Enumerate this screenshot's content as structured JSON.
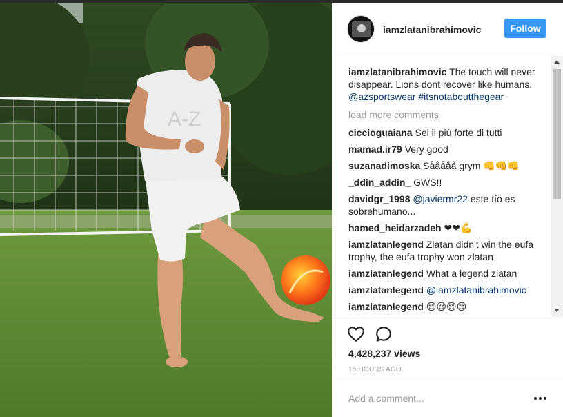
{
  "post": {
    "username": "iamzlatanibrahimovic",
    "follow_label": "Follow",
    "caption": {
      "username": "iamzlatanibrahimovic",
      "text": "The touch will never disappear. Lions dont recover like humans.",
      "mention": "@azsportswear",
      "hashtag": "#itsnotaboutthegear"
    },
    "shirt_text": "A-Z"
  },
  "comments": {
    "load_more_label": "load more comments",
    "items": [
      {
        "user": "ciccioguaiana",
        "text": "Sei il più forte di tutti"
      },
      {
        "user": "mamad.ir79",
        "text": "Very good"
      },
      {
        "user": "suzanadimoska",
        "text": "Sååååå grym 👊👊👊"
      },
      {
        "user": "_ddin_addin_",
        "text": "GWS!!"
      },
      {
        "user": "davidgr_1998",
        "mention": "@javiermr22",
        "text": "este tío es sobrehumano..."
      },
      {
        "user": "hamed_heidarzadeh",
        "text": "❤❤💪"
      },
      {
        "user": "iamzlatanlegend",
        "text": "Zlatan didn't win the eufa trophy, the eufa trophy won zlatan"
      },
      {
        "user": "iamzlatanlegend",
        "text": "What a legend zlatan"
      },
      {
        "user": "iamzlatanlegend",
        "mention": "@iamzlatanibrahimovic"
      },
      {
        "user": "iamzlatanlegend",
        "text": "😌😌😌😌"
      }
    ]
  },
  "actions": {
    "like_icon": "heart-icon",
    "comment_icon": "speech-bubble-icon",
    "views": "4,428,237 views",
    "time": "15 HOURS AGO"
  },
  "add_comment": {
    "placeholder": "Add a comment...",
    "more_icon": "ellipsis-icon"
  },
  "colors": {
    "accent": "#3897f0",
    "link": "#003569",
    "muted": "#999999"
  }
}
